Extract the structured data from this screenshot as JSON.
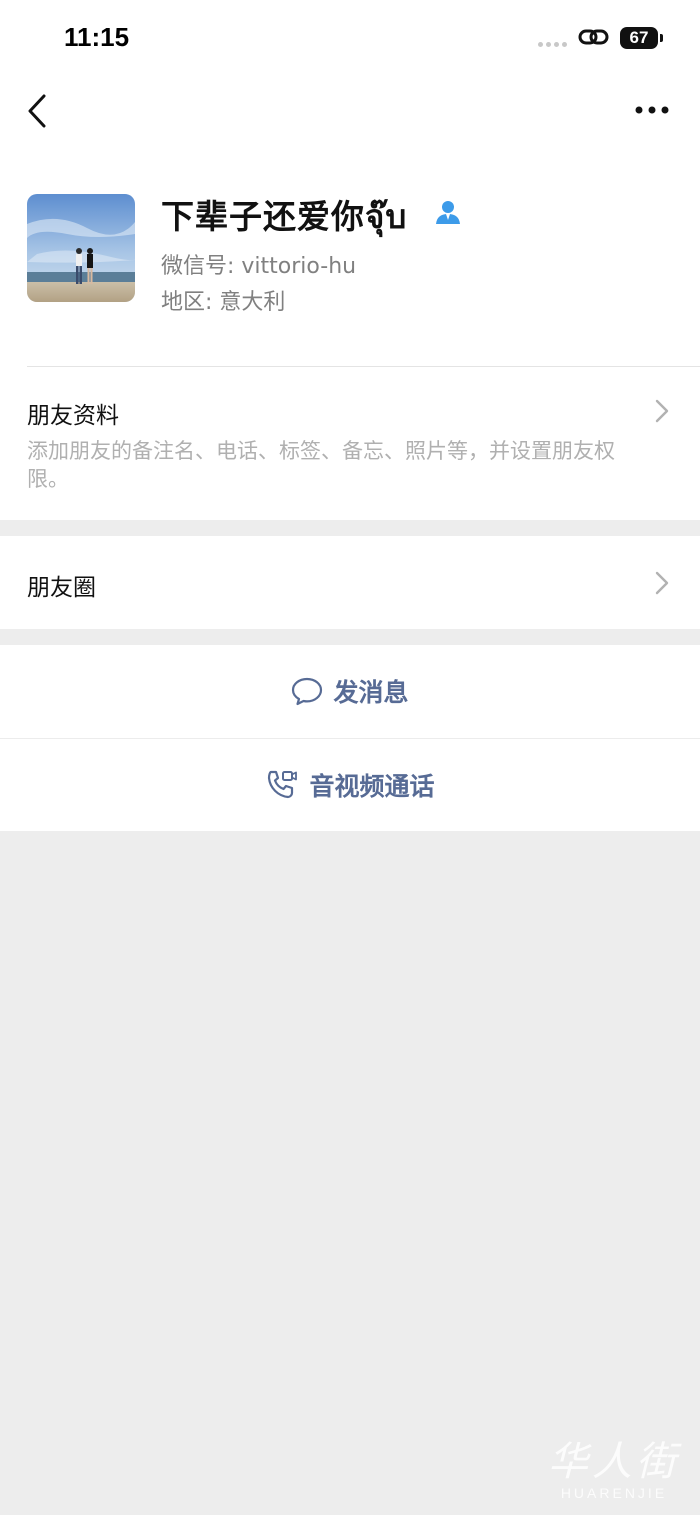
{
  "status_bar": {
    "time": "11:15",
    "battery": "67"
  },
  "profile": {
    "nickname": "下辈子还爱你จุ๊บ",
    "wechat_id_text": "微信号: vittorio-hu",
    "region_text": "地区: 意大利"
  },
  "friend_profile_row": {
    "title": "朋友资料",
    "description": "添加朋友的备注名、电话、标签、备忘、照片等，并设置朋友权限。"
  },
  "moments_row": {
    "title": "朋友圈"
  },
  "actions": {
    "send_message": "发消息",
    "video_call": "音视频通话"
  },
  "watermark": {
    "chinese": "华人街",
    "english": "HUARENJIE"
  },
  "colors": {
    "accent_link": "#576b95",
    "contact_badge": "#3d9be9",
    "background": "#ededed"
  },
  "icons": [
    "back-icon",
    "more-icon",
    "contact-badge-icon",
    "chevron-right-icon",
    "message-bubble-icon",
    "video-call-icon",
    "link-icon"
  ]
}
